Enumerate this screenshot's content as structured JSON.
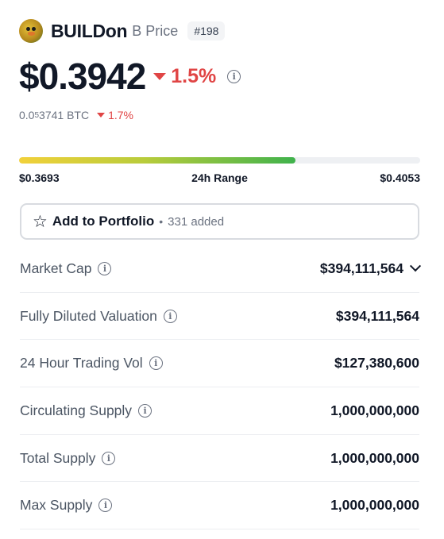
{
  "header": {
    "name": "BUILDon",
    "subtitle": "B Price",
    "rank": "#198"
  },
  "price": {
    "value": "$0.3942",
    "change": "1.5%",
    "change_direction": "down",
    "change_color": "#e04545"
  },
  "btc": {
    "prefix": "0.0",
    "zeros": "5",
    "digits": "3741 BTC",
    "change": "1.7%"
  },
  "range": {
    "low": "$0.3693",
    "label": "24h Range",
    "high": "$0.4053",
    "position_fraction": 0.69
  },
  "portfolio": {
    "label": "Add to Portfolio",
    "separator": "•",
    "added": "331 added"
  },
  "stats": [
    {
      "label": "Market Cap",
      "value": "$394,111,564"
    },
    {
      "label": "Fully Diluted Valuation",
      "value": "$394,111,564"
    },
    {
      "label": "24 Hour Trading Vol",
      "value": "$127,380,600"
    },
    {
      "label": "Circulating Supply",
      "value": "1,000,000,000"
    },
    {
      "label": "Total Supply",
      "value": "1,000,000,000"
    },
    {
      "label": "Max Supply",
      "value": "1,000,000,000"
    }
  ],
  "icons": {
    "info": "info-icon",
    "star": "star-icon",
    "expand": "chevron-down-icon"
  }
}
